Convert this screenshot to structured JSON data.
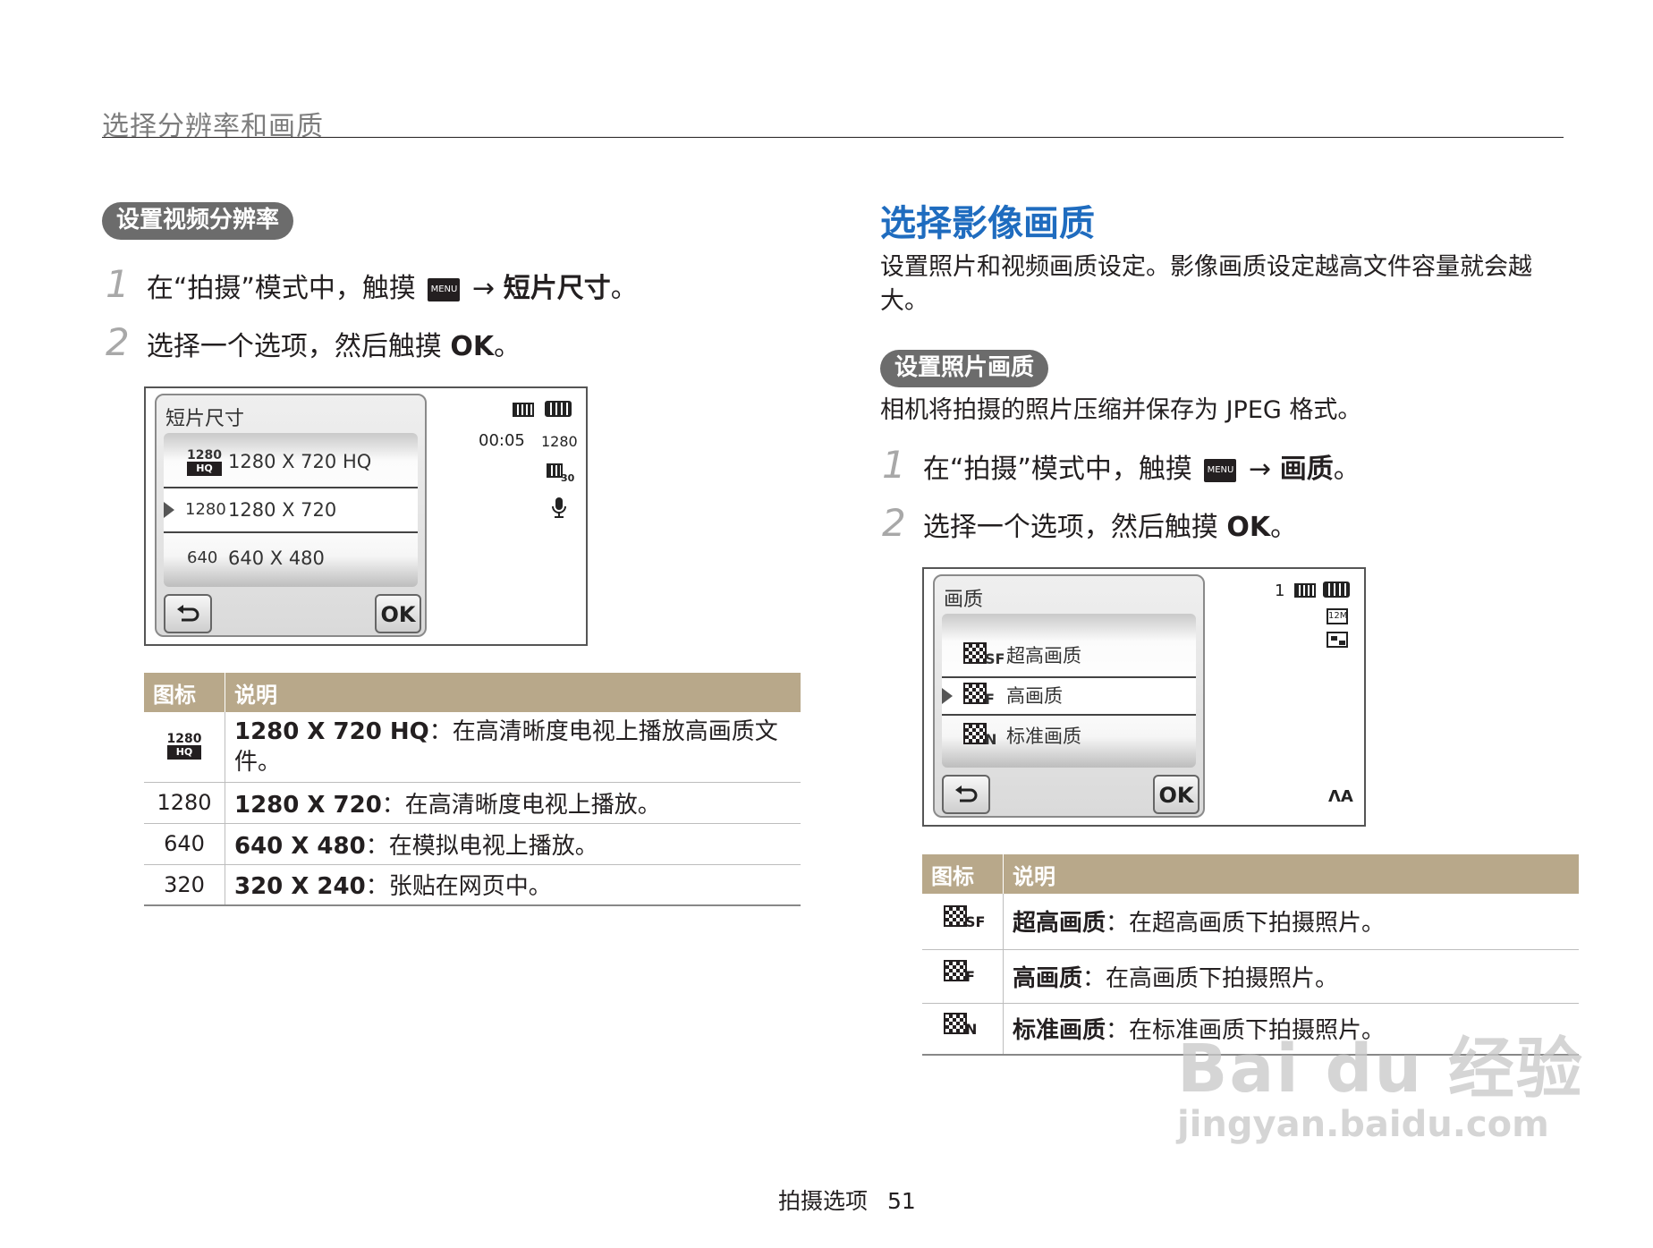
{
  "header": {
    "title": "选择分辨率和画质"
  },
  "left": {
    "pill": "设置视频分辨率",
    "steps": [
      {
        "num": "1",
        "pre": "在“拍摄”模式中，触摸",
        "menu": "MENU",
        "arrow": "→",
        "bold": "短片尺寸",
        "post": "。"
      },
      {
        "num": "2",
        "pre": "选择一个选项，然后触摸",
        "bold": "OK",
        "post": "。"
      }
    ],
    "screen": {
      "title": "短片尺寸",
      "options": [
        {
          "icon_top": "1280",
          "icon_bottom": "HQ",
          "label": "1280 X 720 HQ"
        },
        {
          "icon": "1280",
          "label": "1280 X 720"
        },
        {
          "icon": "640",
          "label": "640 X 480"
        }
      ],
      "time": "00:05",
      "res": "1280",
      "fps": "30",
      "back_icon": "back-arrow-icon",
      "ok": "OK"
    },
    "table": {
      "col_icon": "图标",
      "col_desc": "说明",
      "rows": [
        {
          "icon_top": "1280",
          "icon_bottom": "HQ",
          "bold": "1280 X 720 HQ",
          "text": "：在高清晰度电视上播放高画质文件。"
        },
        {
          "icon": "1280",
          "bold": "1280 X 720",
          "text": "：在高清晰度电视上播放。"
        },
        {
          "icon": "640",
          "bold": "640 X 480",
          "text": "：在模拟电视上播放。"
        },
        {
          "icon": "320",
          "bold": "320 X 240",
          "text": "：张贴在网页中。"
        }
      ]
    }
  },
  "right": {
    "title": "选择影像画质",
    "intro": "设置照片和视频画质设定。影像画质设定越高文件容量就会越大。",
    "pill": "设置照片画质",
    "desc": "相机将拍摄的照片压缩并保存为 JPEG 格式。",
    "steps": [
      {
        "num": "1",
        "pre": "在“拍摄”模式中，触摸",
        "menu": "MENU",
        "arrow": "→",
        "bold": "画质",
        "post": "。"
      },
      {
        "num": "2",
        "pre": "选择一个选项，然后触摸",
        "bold": "OK",
        "post": "。"
      }
    ],
    "screen": {
      "title": "画质",
      "options": [
        {
          "suffix": "SF",
          "label": "超高画质"
        },
        {
          "suffix": "F",
          "label": "高画质"
        },
        {
          "suffix": "N",
          "label": "标准画质"
        }
      ],
      "count": "1",
      "size": "12M",
      "flash": "ɅA",
      "ok": "OK"
    },
    "table": {
      "col_icon": "图标",
      "col_desc": "说明",
      "rows": [
        {
          "suffix": "SF",
          "bold": "超高画质",
          "text": "：在超高画质下拍摄照片。"
        },
        {
          "suffix": "F",
          "bold": "高画质",
          "text": "：在高画质下拍摄照片。"
        },
        {
          "suffix": "N",
          "bold": "标准画质",
          "text": "：在标准画质下拍摄照片。"
        }
      ]
    }
  },
  "footer": {
    "section": "拍摄选项",
    "page": "51"
  },
  "watermark": {
    "brand": "Bai du 经验",
    "url": "jingyan.baidu.com"
  }
}
